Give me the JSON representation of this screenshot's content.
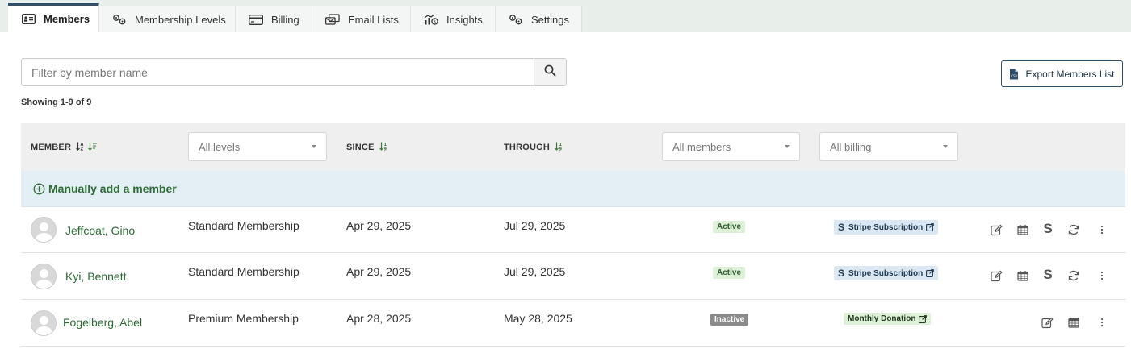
{
  "tabs": [
    {
      "label": "Members",
      "icon": "id-card-icon",
      "active": true
    },
    {
      "label": "Membership Levels",
      "icon": "cogs-icon"
    },
    {
      "label": "Billing",
      "icon": "credit-card-icon"
    },
    {
      "label": "Email Lists",
      "icon": "mail-bulk-icon"
    },
    {
      "label": "Insights",
      "icon": "chart-icon"
    },
    {
      "label": "Settings",
      "icon": "cogs-icon"
    }
  ],
  "search": {
    "placeholder": "Filter by member name"
  },
  "export_label": "Export Members List",
  "showing": "Showing 1-9 of 9",
  "columns": {
    "member": "MEMBER",
    "levels_filter": "All levels",
    "since": "SINCE",
    "through": "THROUGH",
    "members_filter": "All members",
    "billing_filter": "All billing"
  },
  "add_member_label": "Manually add a member",
  "rows": [
    {
      "name": "Jeffcoat, Gino",
      "level": "Standard Membership",
      "since": "Apr 29, 2025",
      "through": "Jul 29, 2025",
      "status": "Active",
      "billing": "Stripe Subscription"
    },
    {
      "name": "Kyi, Bennett",
      "level": "Standard Membership",
      "since": "Apr 29, 2025",
      "through": "Jul 29, 2025",
      "status": "Active",
      "billing": "Stripe Subscription"
    },
    {
      "name": "Fogelberg, Abel",
      "level": "Premium Membership",
      "since": "Apr 28, 2025",
      "through": "May 28, 2025",
      "status": "Inactive",
      "billing": "Monthly Donation"
    }
  ],
  "colors": {
    "accent": "#2f4f6a",
    "link_green": "#2e6b35",
    "add_row_bg": "#e4eef5"
  }
}
